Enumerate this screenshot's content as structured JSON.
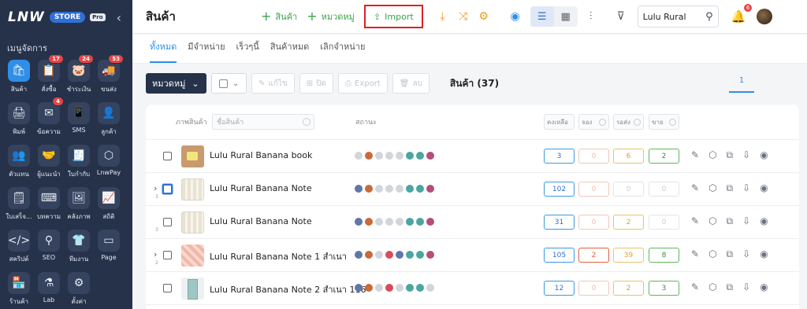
{
  "brand": {
    "logo": "LNW",
    "store": "STORE",
    "pro": "Pro"
  },
  "sidebar": {
    "title": "เมนูจัดการ",
    "items": [
      {
        "label": "สินค้า",
        "icon": "🛍",
        "badge": ""
      },
      {
        "label": "สั่งซื้อ",
        "icon": "📋",
        "badge": "17"
      },
      {
        "label": "ชำระเงิน",
        "icon": "🐷",
        "badge": "24"
      },
      {
        "label": "ขนส่ง",
        "icon": "🚚",
        "badge": "53"
      },
      {
        "label": "พิมพ์",
        "icon": "🖨",
        "badge": ""
      },
      {
        "label": "ข้อความ",
        "icon": "✉",
        "badge": "4"
      },
      {
        "label": "SMS",
        "icon": "📱",
        "badge": ""
      },
      {
        "label": "ลูกค้า",
        "icon": "👤",
        "badge": ""
      },
      {
        "label": "ตัวแทน",
        "icon": "👥",
        "badge": ""
      },
      {
        "label": "ผู้แนะนำ",
        "icon": "🤝",
        "badge": ""
      },
      {
        "label": "ใบกำกับ",
        "icon": "🧾",
        "badge": ""
      },
      {
        "label": "LnwPay",
        "icon": "⬡",
        "badge": ""
      },
      {
        "label": "ใบเสร็จ...",
        "icon": "🗒",
        "badge": ""
      },
      {
        "label": "บทความ",
        "icon": "⌨",
        "badge": ""
      },
      {
        "label": "คลังภาพ",
        "icon": "🖼",
        "badge": ""
      },
      {
        "label": "สถิติ",
        "icon": "📈",
        "badge": ""
      },
      {
        "label": "สคริปต์",
        "icon": "</>",
        "badge": ""
      },
      {
        "label": "SEO",
        "icon": "⚲",
        "badge": ""
      },
      {
        "label": "ทีมงาน",
        "icon": "👕",
        "badge": ""
      },
      {
        "label": "Page",
        "icon": "▭",
        "badge": ""
      },
      {
        "label": "ร้านค้า",
        "icon": "🏪",
        "badge": ""
      },
      {
        "label": "Lab",
        "icon": "⚗",
        "badge": ""
      },
      {
        "label": "ตั้งค่า",
        "icon": "⚙",
        "badge": ""
      }
    ]
  },
  "header": {
    "title": "สินค้า",
    "add_product": "สินค้า",
    "add_category": "หมวดหมู่",
    "import": "Import",
    "search_value": "Lulu Rural",
    "notification_count": "6"
  },
  "tabs": [
    "ทั้งหมด",
    "มีจำหน่าย",
    "เร็วๆนี้",
    "สินค้าหมด",
    "เลิกจำหน่าย"
  ],
  "toolbar": {
    "category": "หมวดหมู่",
    "edit": "แก้ไข",
    "duplicate": "ปิด",
    "export": "Export",
    "delete": "ลบ",
    "count_label": "สินค้า (37)",
    "page": "1"
  },
  "table": {
    "col_image": "ภาพสินค้า",
    "col_name": "ชื่อสินค้า",
    "col_status": "สถานะ",
    "col_stock": "คงเหลือ",
    "col_reserve": "จอง",
    "col_wait": "รอส่ง",
    "col_sold": "ขาย",
    "rows": [
      {
        "name": "Lulu Rural Banana book",
        "stock": "3",
        "reserve": "0",
        "wait": "6",
        "sold": "2",
        "thumb": "book",
        "expand": false,
        "sub": ""
      },
      {
        "name": "Lulu Rural Banana Note",
        "stock": "102",
        "reserve": "0",
        "wait": "0",
        "sold": "0",
        "thumb": "note",
        "expand": true,
        "sub": "3"
      },
      {
        "name": "Lulu Rural Banana Note",
        "stock": "31",
        "reserve": "0",
        "wait": "2",
        "sold": "0",
        "thumb": "note",
        "expand": false,
        "sub": "3"
      },
      {
        "name": "Lulu Rural Banana Note 1 สำเนา",
        "stock": "105",
        "reserve": "2",
        "wait": "39",
        "sold": "8",
        "thumb": "pink",
        "expand": true,
        "sub": "2"
      },
      {
        "name": "Lulu Rural Banana Note 2 สำเนา 116",
        "stock": "12",
        "reserve": "0",
        "wait": "2",
        "sold": "3",
        "thumb": "blue",
        "expand": false,
        "sub": ""
      }
    ]
  }
}
